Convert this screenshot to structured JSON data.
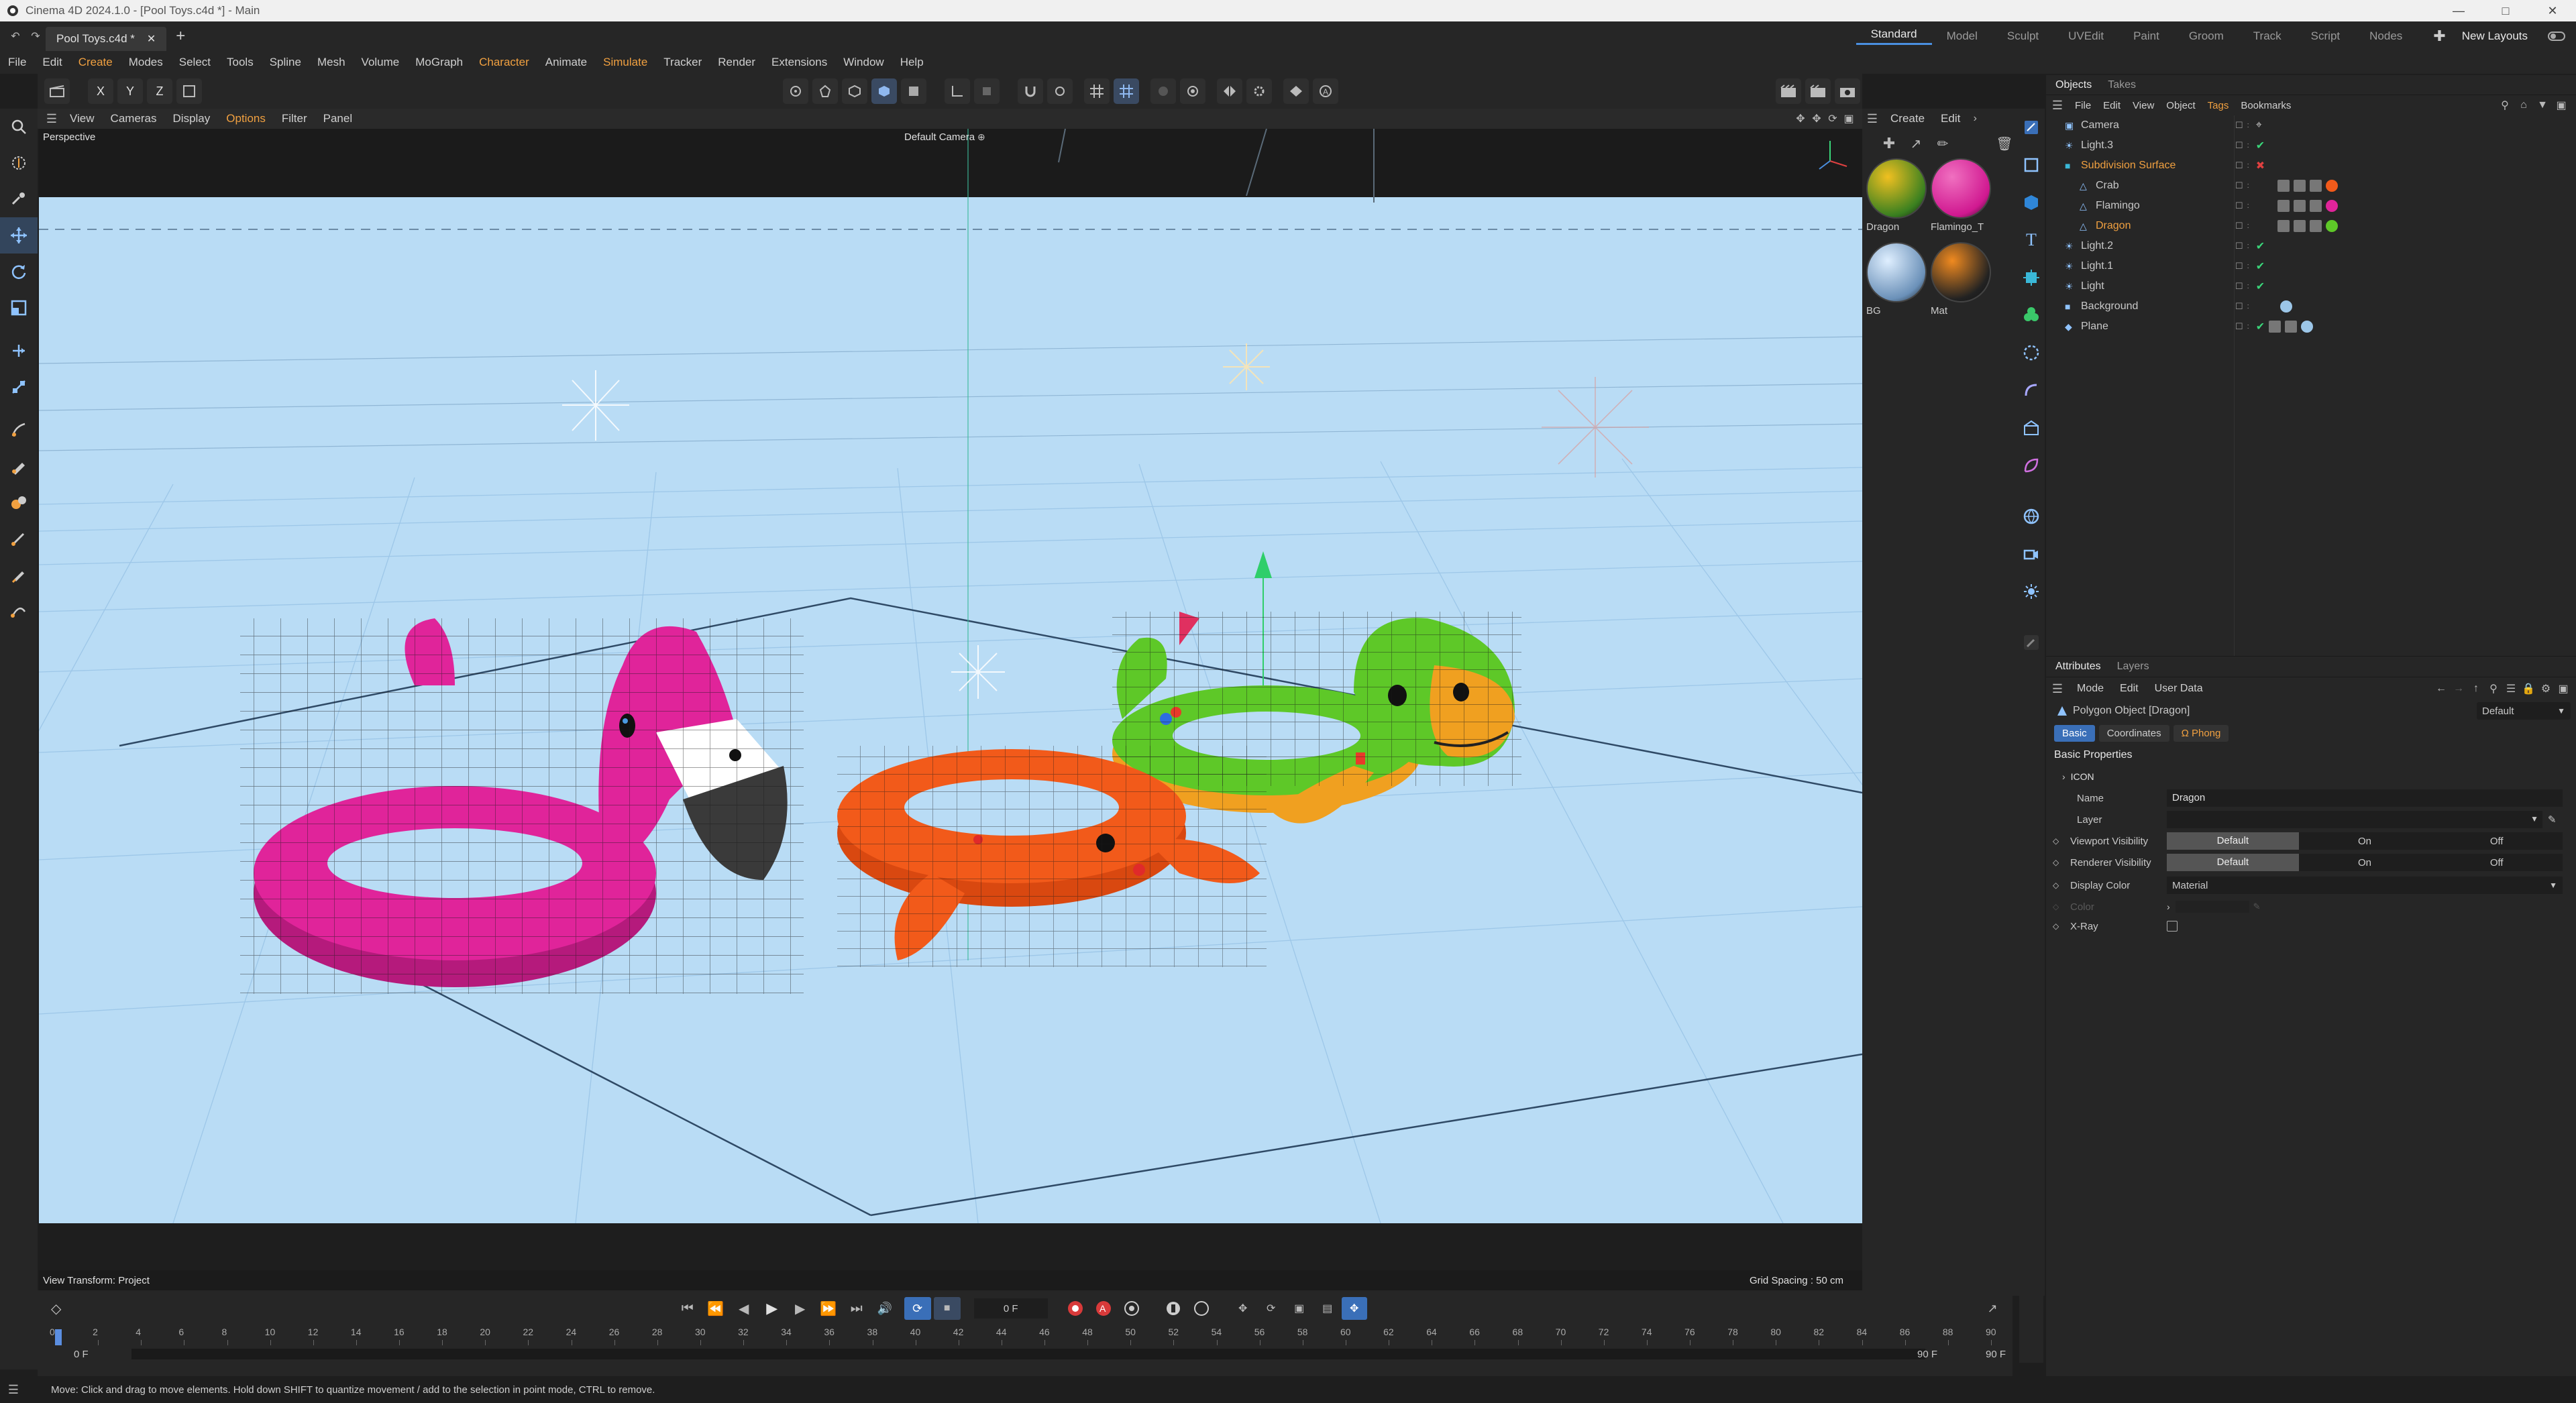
{
  "app": {
    "window_title": "Cinema 4D 2024.1.0 - [Pool Toys.c4d *] - Main"
  },
  "tabs": {
    "doc_tab": "Pool Toys.c4d *",
    "add": "+"
  },
  "layouts": {
    "items": [
      "Standard",
      "Model",
      "Sculpt",
      "UVEdit",
      "Paint",
      "Groom",
      "Track",
      "Script",
      "Nodes"
    ],
    "active": "Standard",
    "new_layouts": "New Layouts"
  },
  "menubar": {
    "items": [
      "File",
      "Edit",
      "Create",
      "Modes",
      "Select",
      "Tools",
      "Spline",
      "Mesh",
      "Volume",
      "MoGraph",
      "Character",
      "Animate",
      "Simulate",
      "Tracker",
      "Render",
      "Extensions",
      "Window",
      "Help"
    ],
    "orange": [
      "Create",
      "Character",
      "Simulate"
    ]
  },
  "cmdbar": {
    "axes": [
      "X",
      "Y",
      "Z"
    ]
  },
  "viewport": {
    "menu": [
      "View",
      "Cameras",
      "Display",
      "Options",
      "Filter",
      "Panel"
    ],
    "active_menu": "Options",
    "label": "Perspective",
    "camera": "Default Camera",
    "view_transform": "View Transform: Project",
    "grid_spacing": "Grid Spacing : 50 cm",
    "sky_color": "#b9dcf5",
    "colors": {
      "flamingo": "#e0249a",
      "crab": "#f25a1a",
      "dragon_green": "#5ec828",
      "dragon_orange": "#f0a020"
    }
  },
  "materials": {
    "menu": [
      "Create",
      "Edit"
    ],
    "items": [
      {
        "name": "Dragon",
        "kind": "dragon"
      },
      {
        "name": "Flamingo_T",
        "kind": "flamingo"
      },
      {
        "name": "BG",
        "kind": "bg"
      },
      {
        "name": "Mat",
        "kind": "mat"
      }
    ]
  },
  "objects_panel": {
    "tabs": [
      "Objects",
      "Takes"
    ],
    "menu": [
      "File",
      "Edit",
      "View",
      "Object",
      "Tags",
      "Bookmarks"
    ],
    "active_menu": "Tags",
    "rows": [
      {
        "name": "Camera",
        "depth": 0,
        "color": "#c8c8c8",
        "check": "cam"
      },
      {
        "name": "Light.3",
        "depth": 0,
        "color": "#c8c8c8",
        "check": "on"
      },
      {
        "name": "Subdivision Surface",
        "depth": 0,
        "color": "#f0a040",
        "check": "off"
      },
      {
        "name": "Crab",
        "depth": 1,
        "color": "#c8c8c8",
        "check": "tags"
      },
      {
        "name": "Flamingo",
        "depth": 1,
        "color": "#c8c8c8",
        "check": "tags"
      },
      {
        "name": "Dragon",
        "depth": 1,
        "color": "#f0a040",
        "check": "tags"
      },
      {
        "name": "Light.2",
        "depth": 0,
        "color": "#c8c8c8",
        "check": "on"
      },
      {
        "name": "Light.1",
        "depth": 0,
        "color": "#c8c8c8",
        "check": "on"
      },
      {
        "name": "Light",
        "depth": 0,
        "color": "#c8c8c8",
        "check": "on"
      },
      {
        "name": "Background",
        "depth": 0,
        "color": "#c8c8c8",
        "check": "bg"
      },
      {
        "name": "Plane",
        "depth": 0,
        "color": "#c8c8c8",
        "check": "plane"
      }
    ]
  },
  "attributes": {
    "tabs": [
      "Attributes",
      "Layers"
    ],
    "menu": [
      "Mode",
      "Edit",
      "User Data"
    ],
    "object_title": "Polygon Object [Dragon]",
    "preset": "Default",
    "subtabs": [
      "Basic",
      "Coordinates",
      "Phong"
    ],
    "section": "Basic Properties",
    "group_icon": "ICON",
    "fields": {
      "name_label": "Name",
      "name_value": "Dragon",
      "layer_label": "Layer",
      "vv_label": "Viewport Visibility",
      "rv_label": "Renderer Visibility",
      "seg": [
        "Default",
        "On",
        "Off"
      ],
      "dc_label": "Display Color",
      "dc_value": "Material",
      "color_label": "Color",
      "xray_label": "X-Ray"
    }
  },
  "timeline": {
    "current_frame": "0 F",
    "start": "0 F",
    "start2": "0 F",
    "end": "90 F",
    "end2": "90 F",
    "ticks": [
      "0",
      "2",
      "4",
      "6",
      "8",
      "10",
      "12",
      "14",
      "16",
      "18",
      "20",
      "22",
      "24",
      "26",
      "28",
      "30",
      "32",
      "34",
      "36",
      "38",
      "40",
      "42",
      "44",
      "46",
      "48",
      "50",
      "52",
      "54",
      "56",
      "58",
      "60",
      "62",
      "64",
      "66",
      "68",
      "70",
      "72",
      "74",
      "76",
      "78",
      "80",
      "82",
      "84",
      "86",
      "88",
      "90"
    ]
  },
  "status": "Move: Click and drag to move elements. Hold down SHIFT to quantize movement / add to the selection in point mode, CTRL to remove."
}
